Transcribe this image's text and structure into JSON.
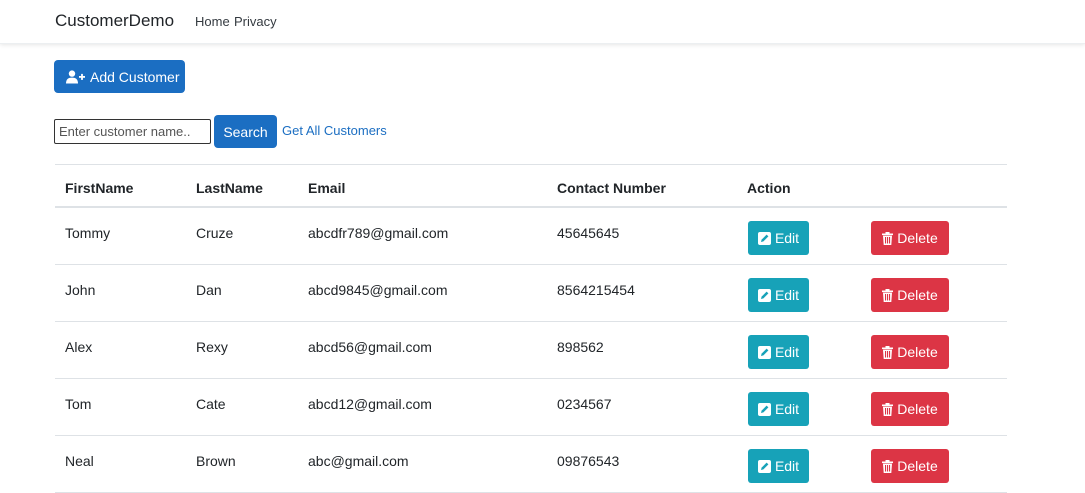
{
  "navbar": {
    "brand": "CustomerDemo",
    "links": [
      "Home",
      "Privacy"
    ]
  },
  "toolbar": {
    "add_label": "Add Customer",
    "search_placeholder": "Enter customer name..",
    "search_value": "",
    "search_label": "Search",
    "get_all_label": "Get All Customers"
  },
  "table": {
    "headers": [
      "FirstName",
      "LastName",
      "Email",
      "Contact Number",
      "Action"
    ],
    "edit_label": "Edit",
    "delete_label": "Delete",
    "rows": [
      [
        "Tommy",
        "Cruze",
        "abcdfr789@gmail.com",
        "45645645"
      ],
      [
        "John",
        "Dan",
        "abcd9845@gmail.com",
        "8564215454"
      ],
      [
        "Alex",
        "Rexy",
        "abcd56@gmail.com",
        "898562"
      ],
      [
        "Tom",
        "Cate",
        "abcd12@gmail.com",
        "0234567"
      ],
      [
        "Neal",
        "Brown",
        "abc@gmail.com",
        "09876543"
      ]
    ]
  },
  "colors": {
    "primary": "#1b6ec2",
    "edit": "#17a2b8",
    "delete": "#dc3545"
  },
  "icons": {
    "add": "user-plus-icon",
    "edit": "edit-icon",
    "delete": "trash-icon"
  }
}
